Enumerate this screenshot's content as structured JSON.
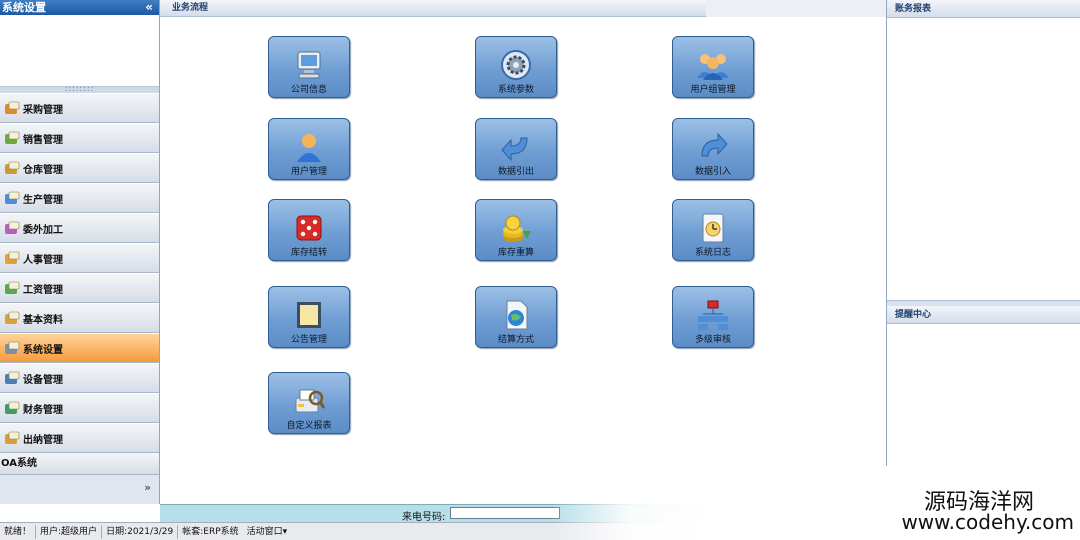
{
  "sidebar": {
    "title": "系统设置",
    "collapse_glyph": "«",
    "splitter_dots": "::::::::",
    "items": [
      {
        "label": "采购管理",
        "active": false,
        "icon": "purchase-icon"
      },
      {
        "label": "销售管理",
        "active": false,
        "icon": "sales-icon"
      },
      {
        "label": "仓库管理",
        "active": false,
        "icon": "warehouse-icon"
      },
      {
        "label": "生产管理",
        "active": false,
        "icon": "production-icon"
      },
      {
        "label": "委外加工",
        "active": false,
        "icon": "outsourcing-icon"
      },
      {
        "label": "人事管理",
        "active": false,
        "icon": "personnel-icon"
      },
      {
        "label": "工资管理",
        "active": false,
        "icon": "payroll-icon"
      },
      {
        "label": "基本资料",
        "active": false,
        "icon": "basic-data-icon"
      },
      {
        "label": "系统设置",
        "active": true,
        "icon": "system-settings-icon"
      },
      {
        "label": "设备管理",
        "active": false,
        "icon": "equipment-icon"
      },
      {
        "label": "财务管理",
        "active": false,
        "icon": "finance-icon"
      },
      {
        "label": "出纳管理",
        "active": false,
        "icon": "cashier-icon"
      }
    ],
    "oa_label": "OA系统",
    "more_glyph": "»"
  },
  "main": {
    "title": "业务流程",
    "tiles": [
      {
        "label": "公司信息",
        "icon": "computer-icon"
      },
      {
        "label": "系统参数",
        "icon": "settings-gear-icon"
      },
      {
        "label": "用户组管理",
        "icon": "user-group-icon"
      },
      {
        "label": "用户管理",
        "icon": "user-icon"
      },
      {
        "label": "数据引出",
        "icon": "export-arrow-icon"
      },
      {
        "label": "数据引入",
        "icon": "import-arrow-icon"
      },
      {
        "label": "库存结转",
        "icon": "dice-icon"
      },
      {
        "label": "库存重算",
        "icon": "coins-icon"
      },
      {
        "label": "系统日志",
        "icon": "log-clock-icon"
      },
      {
        "label": "公告管理",
        "icon": "notice-board-icon"
      },
      {
        "label": "结算方式",
        "icon": "settlement-globe-icon"
      },
      {
        "label": "多级审核",
        "icon": "hierarchy-icon"
      },
      {
        "label": "自定义报表",
        "icon": "custom-report-icon"
      }
    ]
  },
  "right": {
    "top_title": "账务报表",
    "bottom_title": "提醒中心"
  },
  "caller": {
    "label": "来电号码:",
    "value": ""
  },
  "status": {
    "ready": "就绪！",
    "user": "用户:超级用户",
    "date": "日期:2021/3/29",
    "account": "帐套:ERP系统",
    "window": "活动窗口▾"
  },
  "watermark": {
    "cn": "源码海洋网",
    "url": "www.codehy.com"
  }
}
